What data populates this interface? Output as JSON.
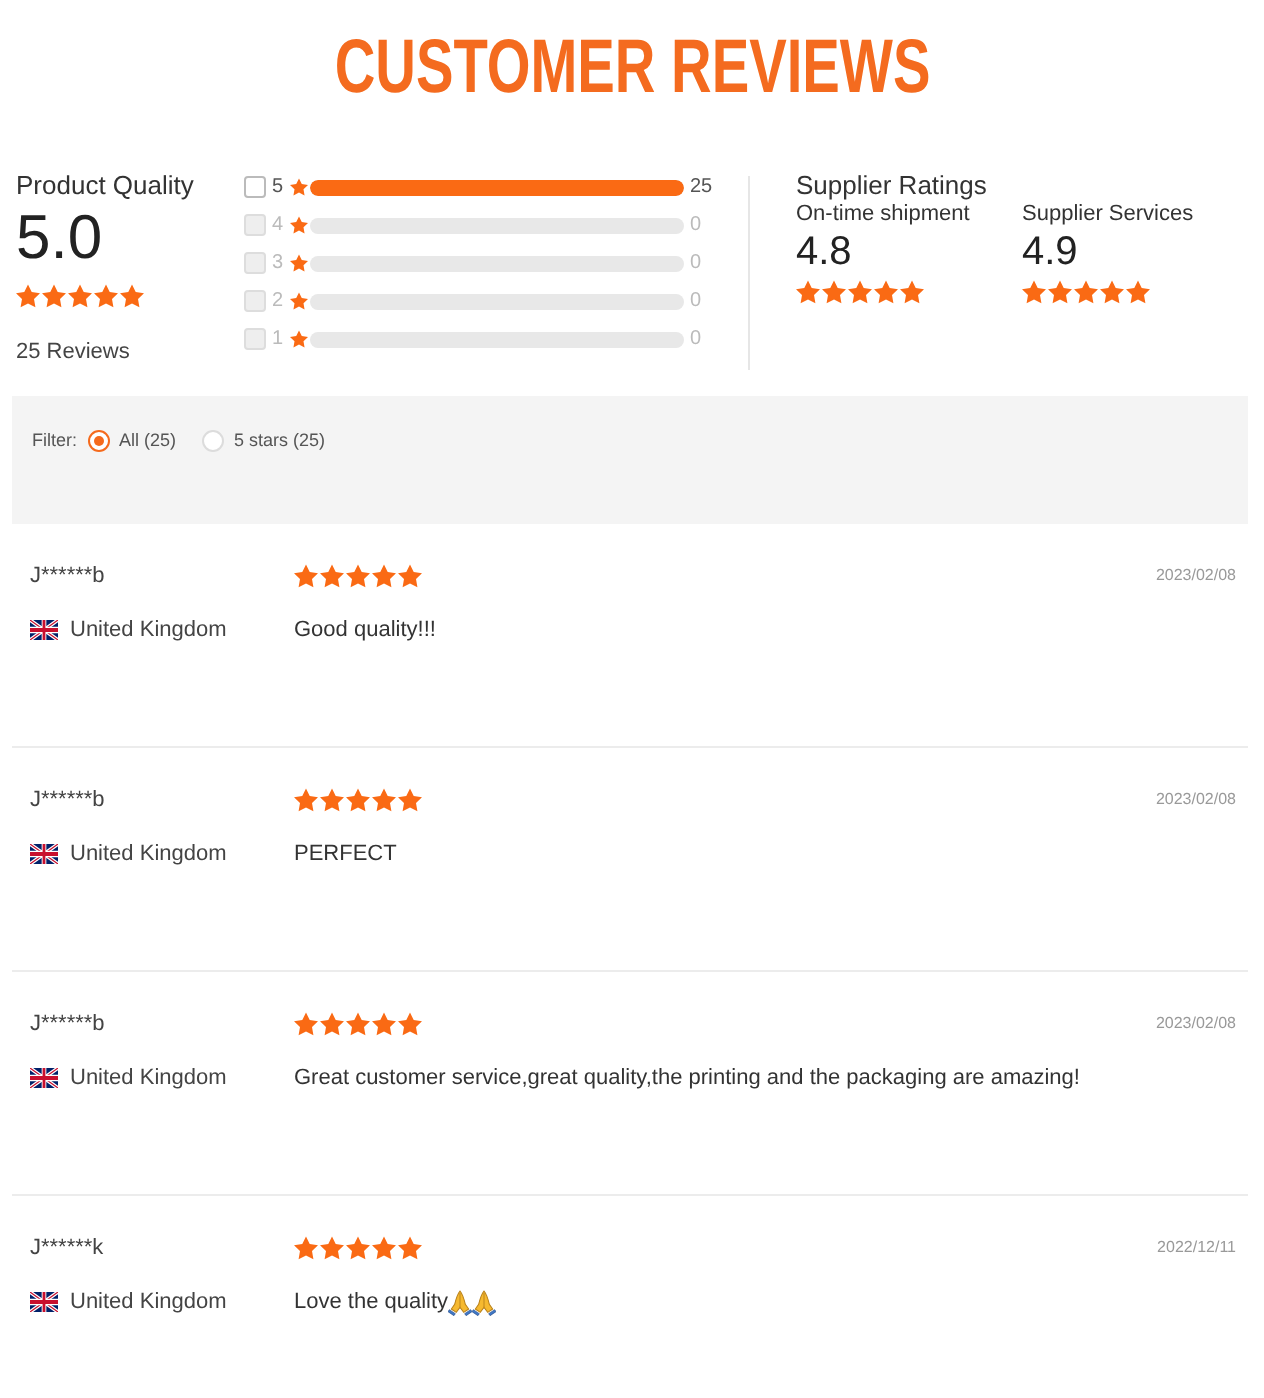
{
  "title": "CUSTOMER REVIEWS",
  "product_quality": {
    "label": "Product Quality",
    "score": "5.0",
    "stars": 5,
    "review_count": "25 Reviews"
  },
  "star_breakdown": [
    {
      "label": "5",
      "checked": false,
      "disabled": false,
      "level": 1,
      "count": "25"
    },
    {
      "label": "4",
      "checked": false,
      "disabled": true,
      "level": 0,
      "count": "0"
    },
    {
      "label": "3",
      "checked": false,
      "disabled": true,
      "level": 0,
      "count": "0"
    },
    {
      "label": "2",
      "checked": false,
      "disabled": true,
      "level": 0,
      "count": "0"
    },
    {
      "label": "1",
      "checked": false,
      "disabled": true,
      "level": 0,
      "count": "0"
    }
  ],
  "supplier_ratings": {
    "title": "Supplier Ratings",
    "items": [
      {
        "label": "On-time shipment",
        "score": "4.8",
        "stars": 5
      },
      {
        "label": "Supplier Services",
        "score": "4.9",
        "stars": 5
      }
    ]
  },
  "filter": {
    "label": "Filter:",
    "options": [
      {
        "label": "All (25)",
        "selected": true
      },
      {
        "label": "5 stars (25)",
        "selected": false
      }
    ]
  },
  "reviews": [
    {
      "name": "J******b",
      "stars": 5,
      "date": "2023/02/08",
      "country": "United Kingdom",
      "text": "Good quality!!!"
    },
    {
      "name": "J******b",
      "stars": 5,
      "date": "2023/02/08",
      "country": "United Kingdom",
      "text": "PERFECT"
    },
    {
      "name": "J******b",
      "stars": 5,
      "date": "2023/02/08",
      "country": "United Kingdom",
      "text": "Great customer service,great quality,the printing and the packaging are amazing!"
    },
    {
      "name": "J******k",
      "stars": 5,
      "date": "2022/12/11",
      "country": "United Kingdom",
      "text": "Love the quality",
      "emojis": [
        {
          "kind": "praying-hands"
        },
        {
          "kind": "praying-hands"
        }
      ]
    }
  ]
}
